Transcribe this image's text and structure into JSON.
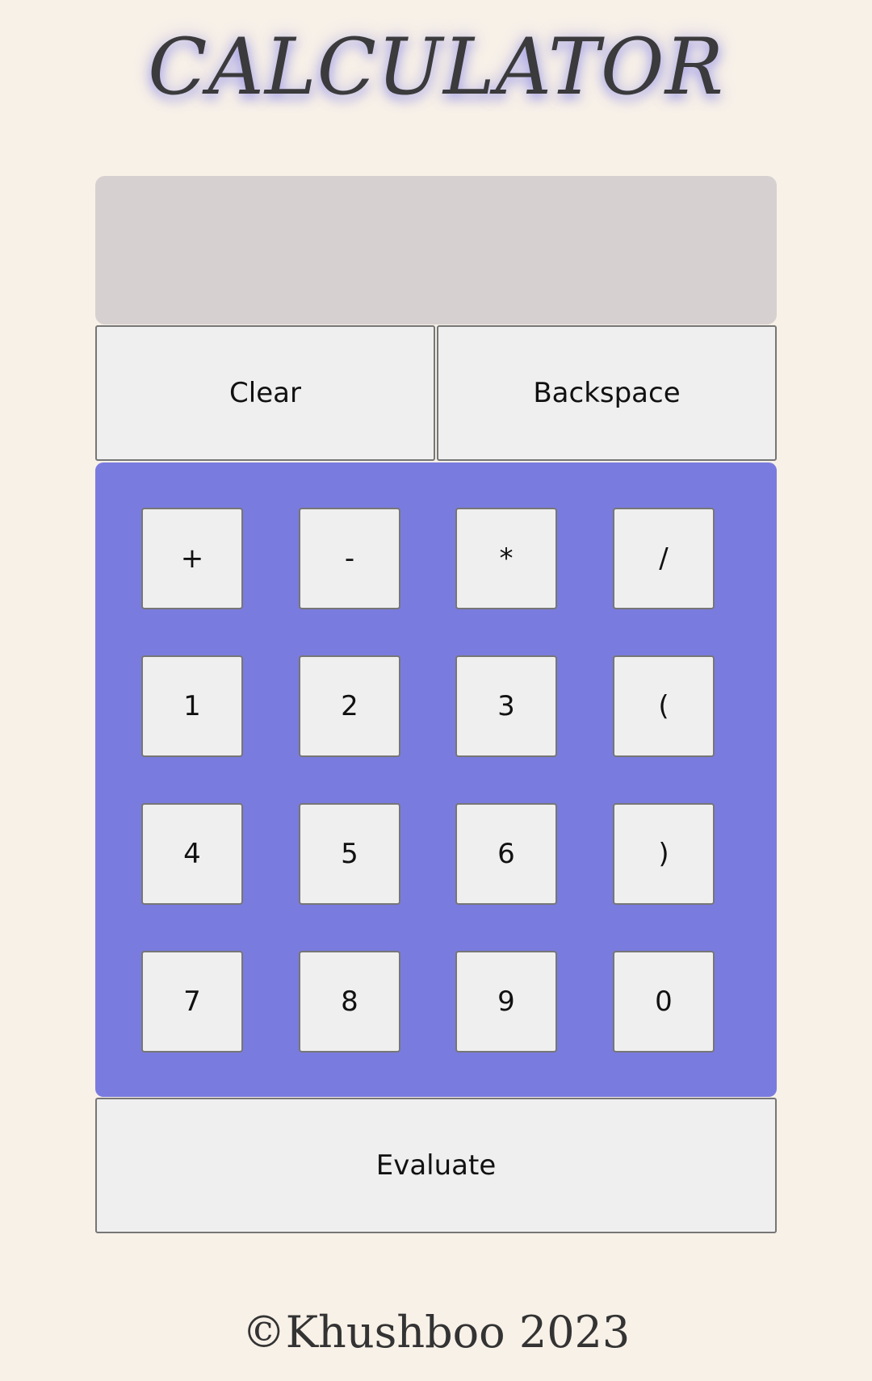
{
  "header": {
    "title": "CALCULATOR"
  },
  "display": {
    "value": ""
  },
  "controls": {
    "clear_label": "Clear",
    "backspace_label": "Backspace",
    "evaluate_label": "Evaluate"
  },
  "keypad": {
    "keys": [
      "+",
      "-",
      "*",
      "/",
      "1",
      "2",
      "3",
      "(",
      "4",
      "5",
      "6",
      ")",
      "7",
      "8",
      "9",
      "0"
    ]
  },
  "footer": {
    "text": "©Khushboo 2023"
  },
  "colors": {
    "background": "#f8f1e8",
    "keypad_background": "#7a7bde",
    "display_background": "#d6d0d0",
    "button_background": "#efefef"
  }
}
